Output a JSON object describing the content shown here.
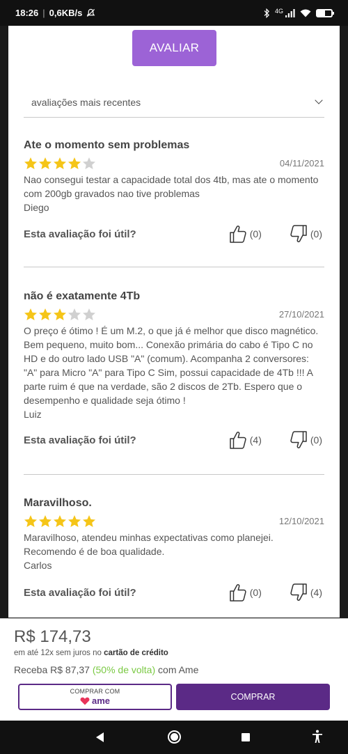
{
  "status_bar": {
    "time": "18:26",
    "speed": "0,6KB/s",
    "signal": "4G"
  },
  "actions": {
    "rate_label": "AVALIAR"
  },
  "sort": {
    "label": "avaliações mais recentes"
  },
  "colors": {
    "accent": "#9c63d6",
    "brand": "#5b2a86",
    "star_filled": "#f5c518",
    "star_empty": "#d0d0d0",
    "cashback_green": "#7ac943"
  },
  "helpful_label": "Esta avaliação foi útil?",
  "reviews": [
    {
      "title": "Ate o momento sem problemas",
      "rating": 4,
      "date": "04/11/2021",
      "text": "Nao consegui testar a capacidade total dos 4tb, mas ate o momento com 200gb gravados nao tive problemas",
      "author": "Diego",
      "up": "(0)",
      "down": "(0)"
    },
    {
      "title": "não é exatamente 4Tb",
      "rating": 3,
      "date": "27/10/2021",
      "text": "O preço é ótimo ! É um M.2, o que já é melhor que disco magnético. Bem pequeno, muito bom... Conexão primária do cabo é Tipo C no HD e do outro lado USB \"A\" (comum). Acompanha 2 conversores: \"A\" para Micro \"A\" para Tipo C Sim, possui capacidade de 4Tb !!! A parte ruim é que na verdade, são 2 discos de 2Tb. Espero que o desempenho e qualidade seja ótimo !",
      "author": "Luiz",
      "up": "(4)",
      "down": "(0)"
    },
    {
      "title": "Maravilhoso.",
      "rating": 5,
      "date": "12/10/2021",
      "text": "Maravilhoso, atendeu minhas expectativas como planejei. Recomendo é de boa qualidade.",
      "author": "Carlos",
      "up": "(0)",
      "down": "(4)"
    }
  ],
  "purchase": {
    "price": "R$ 174,73",
    "installments_prefix": "em até 12x sem juros no",
    "installments_method": "cartão de crédito",
    "cashback_prefix": "Receba R$ 87,37",
    "cashback_highlight": "(50% de volta)",
    "cashback_suffix": "com Ame",
    "ame_button_label": "COMPRAR COM",
    "ame_brand": "ame",
    "buy_button_label": "COMPRAR"
  }
}
